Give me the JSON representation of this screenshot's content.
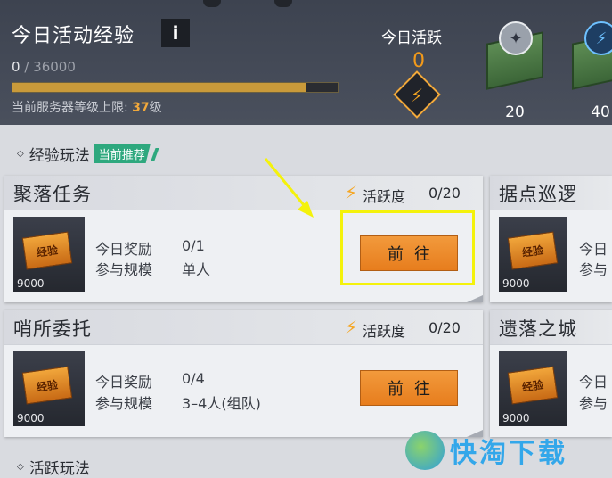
{
  "header": {
    "title": "今日活动经验",
    "info_label": "i",
    "exp_current": "0",
    "exp_separator": "/",
    "exp_max": "36000",
    "exp_progress": 0.9,
    "level_cap_label": "当前服务器等级上限:",
    "level_cap_value": "37",
    "level_cap_unit": "级",
    "activity_label": "今日活跃",
    "activity_value": "0",
    "milestones": [
      {
        "value": "20",
        "icon": "silver-coin-icon"
      },
      {
        "value": "40",
        "icon": "energy-bolt-icon"
      }
    ]
  },
  "sections": {
    "exp_play": {
      "title": "经验玩法",
      "tag": "当前推荐"
    },
    "active_play": {
      "title": "活跃玩法"
    }
  },
  "cards": [
    {
      "title": "聚落任务",
      "activity_label": "活跃度",
      "activity_count": "0/20",
      "reward_label": "今日奖励",
      "reward_value": "0/1",
      "scale_label": "参与规模",
      "scale_value": "单人",
      "thumb_value": "9000",
      "button_label": "前往",
      "ticket_text": "经验"
    },
    {
      "title": "哨所委托",
      "activity_label": "活跃度",
      "activity_count": "0/20",
      "reward_label": "今日奖励",
      "reward_value": "0/4",
      "scale_label": "参与规模",
      "scale_value": "3–4人(组队)",
      "thumb_value": "9000",
      "button_label": "前往",
      "ticket_text": "经验"
    }
  ],
  "side_cards": [
    {
      "title": "据点巡逻",
      "reward_label": "今日",
      "scale_label": "参与",
      "thumb_value": "9000",
      "ticket_text": "经验"
    },
    {
      "title": "遗落之城",
      "reward_label": "今日",
      "scale_label": "参与",
      "thumb_value": "9000",
      "ticket_text": "经验"
    }
  ],
  "icons": {
    "bolt": "⚡",
    "diamond_marker": "◇"
  },
  "colors": {
    "accent_orange": "#e77d1d",
    "tag_green": "#2ea87e",
    "highlight": "#f4f20b",
    "exp_bar": "#c99a3a"
  },
  "watermark": {
    "text": "快淘下载"
  }
}
